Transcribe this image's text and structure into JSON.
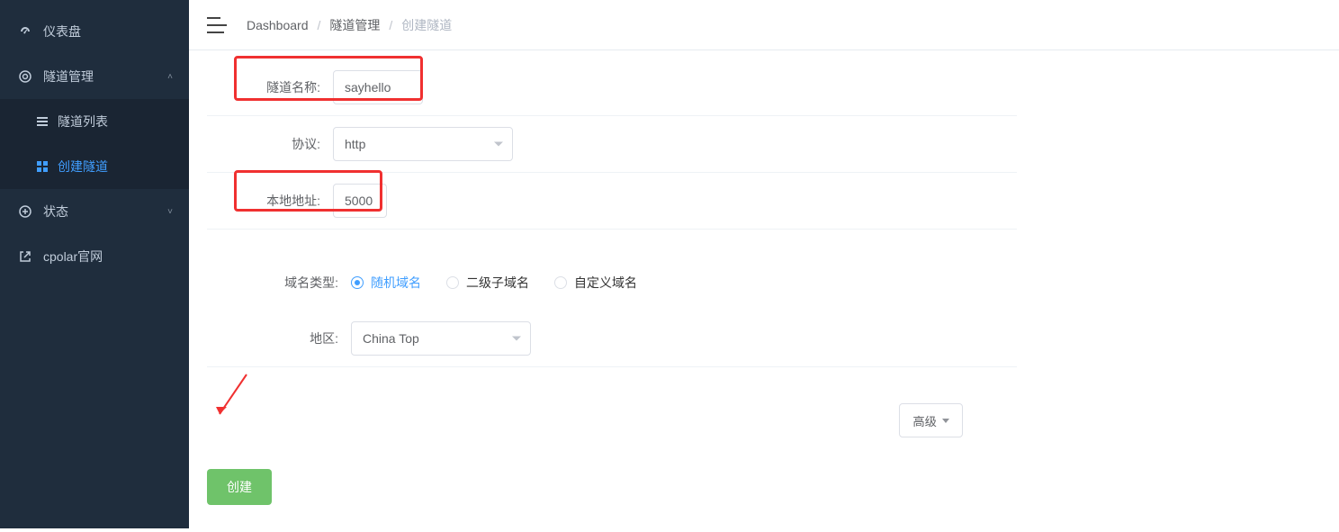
{
  "sidebar": {
    "items": {
      "dashboard": "仪表盘",
      "tunnel": "隧道管理",
      "tunnel_list": "隧道列表",
      "tunnel_create": "创建隧道",
      "status": "状态",
      "site": "cpolar官网"
    }
  },
  "breadcrumbs": {
    "dashboard": "Dashboard",
    "tunnel_mgmt": "隧道管理",
    "create_tunnel": "创建隧道"
  },
  "form": {
    "labels": {
      "name": "隧道名称:",
      "protocol": "协议:",
      "local_addr": "本地地址:",
      "domain_type": "域名类型:",
      "region": "地区:"
    },
    "values": {
      "name": "sayhello",
      "protocol": "http",
      "local_addr": "5000",
      "region": "China Top"
    },
    "domain_options": {
      "random": "随机域名",
      "sub": "二级子域名",
      "custom": "自定义域名"
    },
    "advanced_btn": "高级",
    "create_btn": "创建"
  }
}
